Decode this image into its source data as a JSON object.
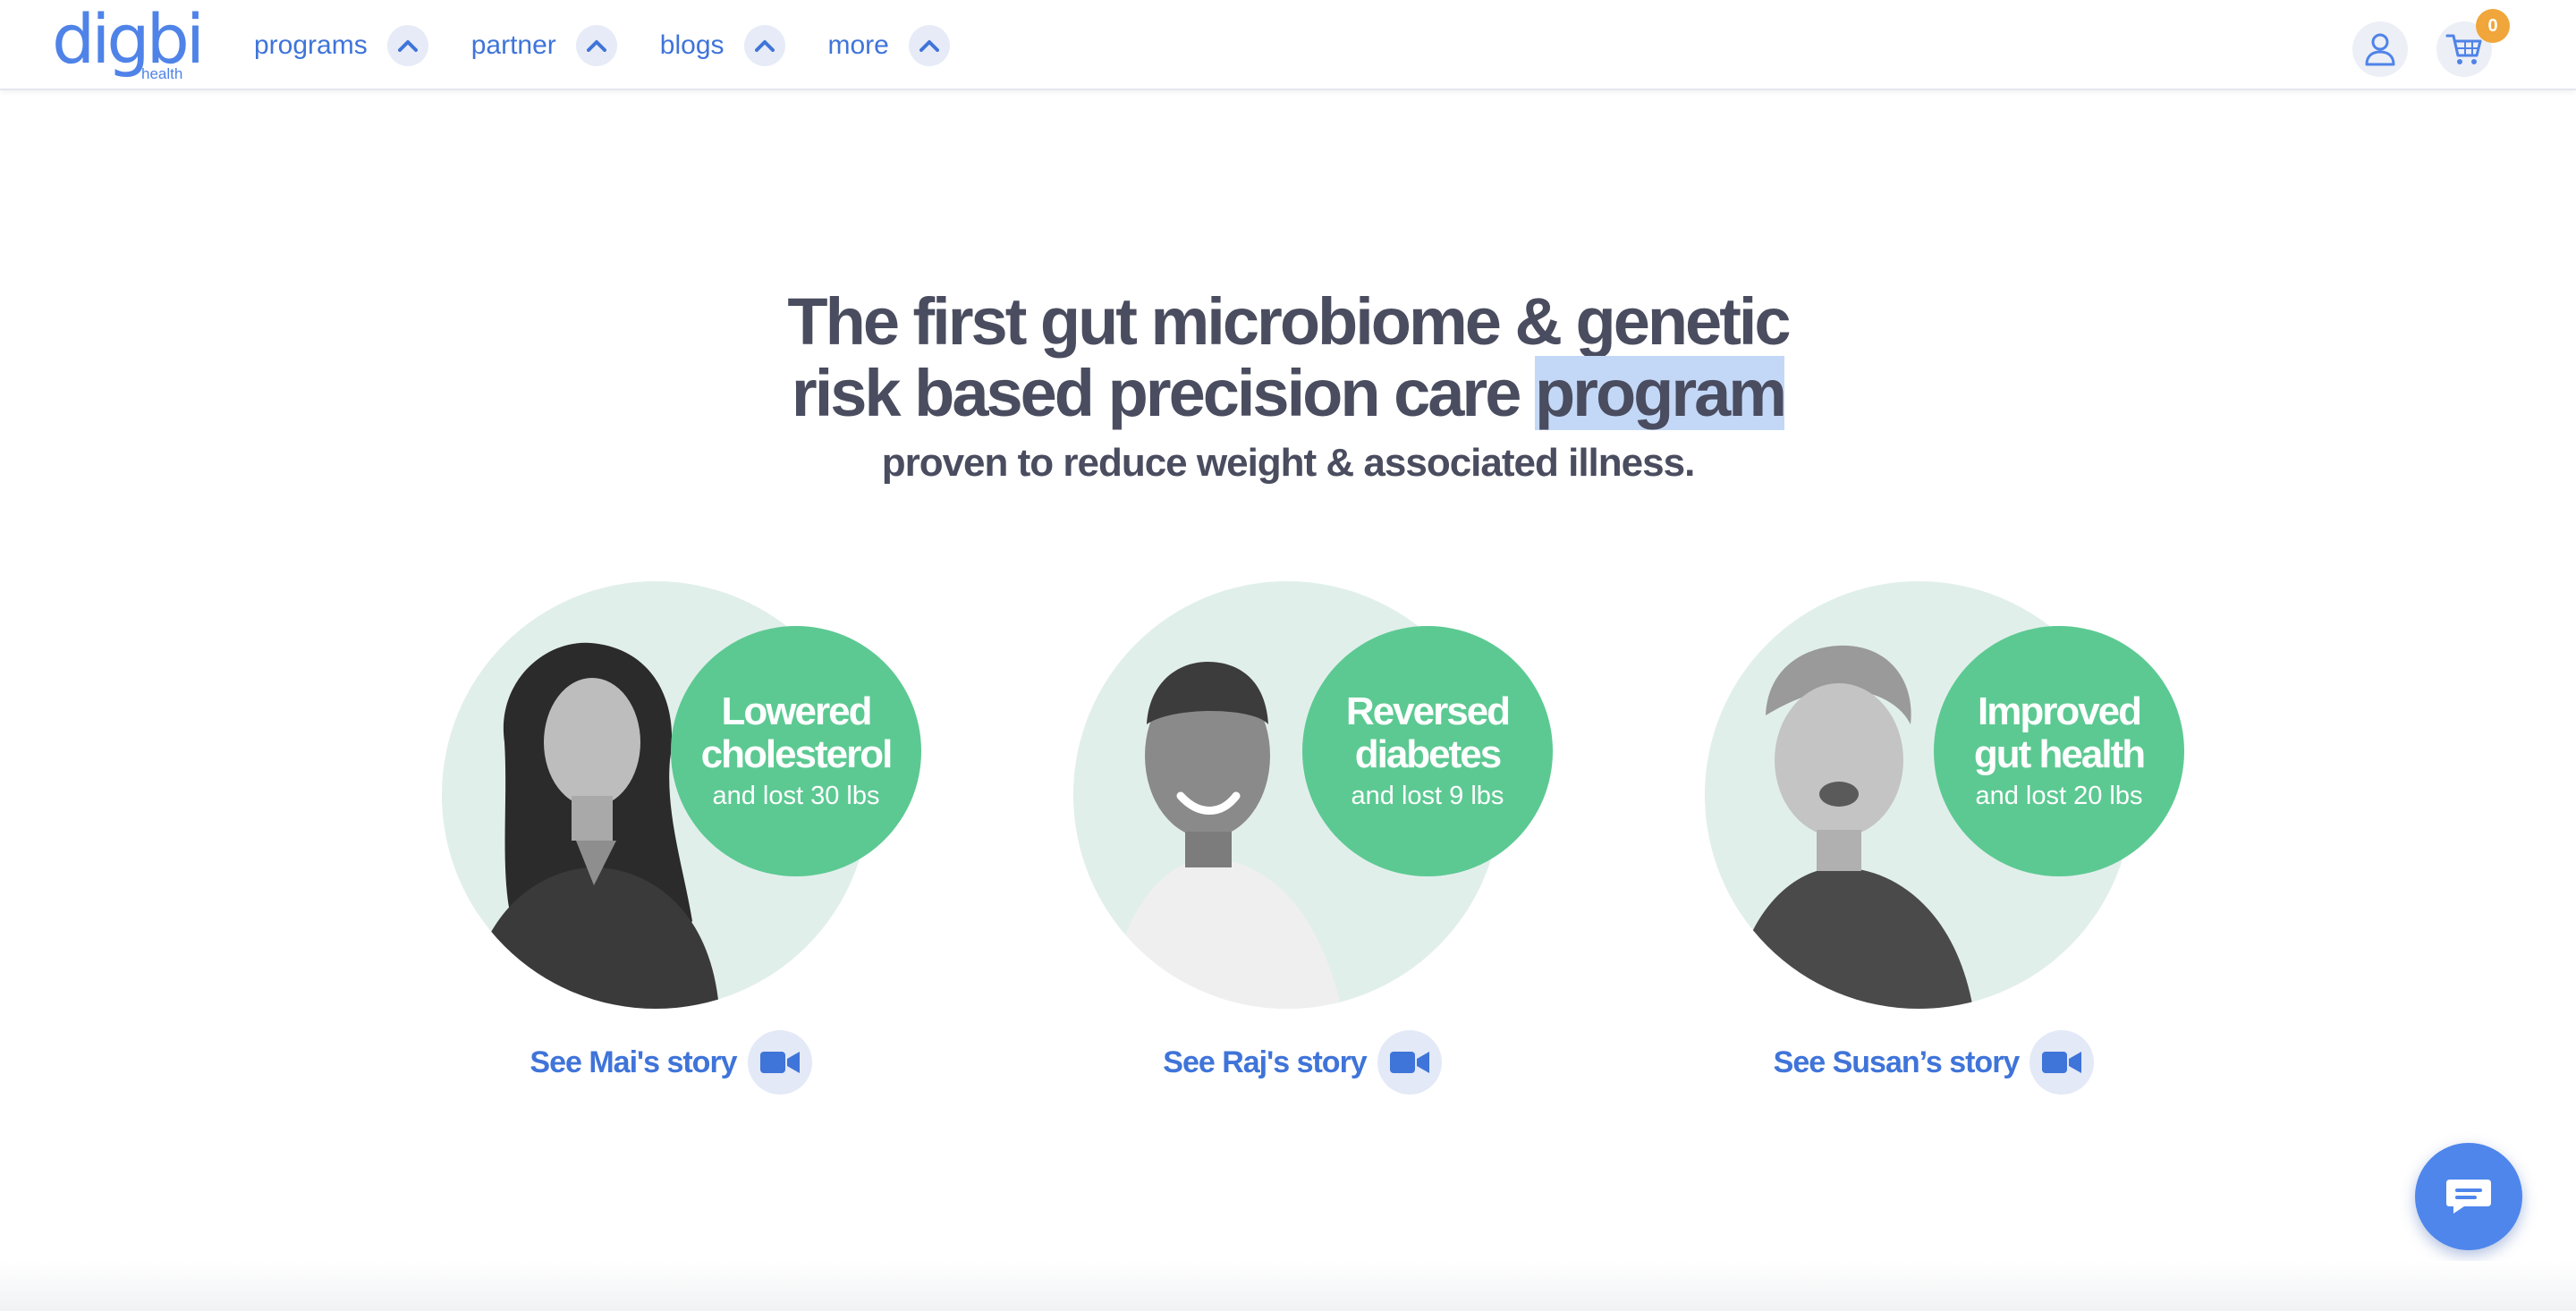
{
  "brand": {
    "name": "digbi",
    "sub": "health",
    "color": "#4f83e8"
  },
  "nav": {
    "items": [
      {
        "label": "programs",
        "icon": "chevron-up-icon"
      },
      {
        "label": "partner",
        "icon": "chevron-up-icon"
      },
      {
        "label": "blogs",
        "icon": "chevron-up-icon"
      },
      {
        "label": "more",
        "icon": "chevron-up-icon"
      }
    ],
    "account_icon": "user-icon",
    "cart_icon": "cart-icon",
    "cart_count": "0"
  },
  "hero": {
    "title_line1": "The first gut microbiome & genetic",
    "title_line2_pre": "risk based precision care ",
    "title_line2_highlight": "program",
    "tagline": "proven to reduce weight & associated illness."
  },
  "stories": [
    {
      "headline_1": "Lowered",
      "headline_2": "cholesterol",
      "detail": "and lost 30 lbs",
      "link": "See Mai's story",
      "icon": "video-camera-icon"
    },
    {
      "headline_1": "Reversed",
      "headline_2": "diabetes",
      "detail": "and lost 9 lbs",
      "link": "See Raj's story",
      "icon": "video-camera-icon"
    },
    {
      "headline_1": "Improved",
      "headline_2": "gut health",
      "detail": "and lost 20 lbs",
      "link": "See Susan’s story",
      "icon": "video-camera-icon"
    }
  ],
  "chat": {
    "icon": "chat-bubble-icon"
  },
  "colors": {
    "accent_blue": "#3f74d9",
    "stat_green": "#5cc992",
    "circle_mint": "#e1efeb",
    "badge_orange": "#f0a63a",
    "highlight": "#c3d8f6"
  }
}
